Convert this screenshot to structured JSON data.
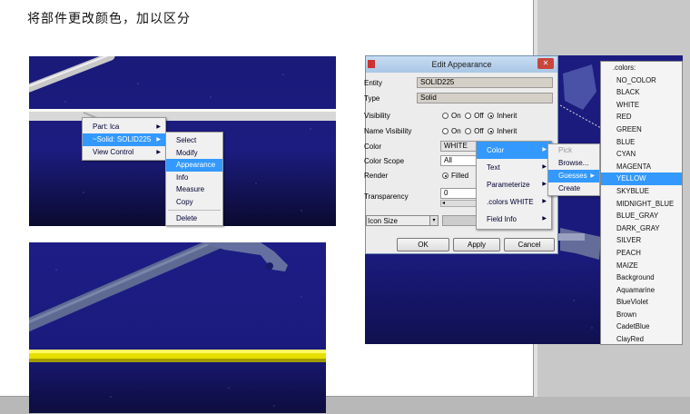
{
  "title": "将部件更改颜色，加以区分",
  "ctx_menu": {
    "level1": [
      {
        "label": "Part: lca",
        "arrow": true
      },
      {
        "label": "~Solid: SOLID225",
        "arrow": true,
        "selected": true
      },
      {
        "label": "View Control",
        "arrow": true
      }
    ],
    "level2": [
      "Select",
      "Modify",
      "Appearance",
      "Info",
      "Measure",
      "Copy",
      "Delete"
    ],
    "level2_selected": "Appearance"
  },
  "dialog": {
    "title": "Edit Appearance",
    "close": "✕",
    "labels": {
      "entity": "Entity",
      "type": "Type",
      "visibility": "Visibility",
      "name_visibility": "Name Visibility",
      "color": "Color",
      "color_scope": "Color Scope",
      "render": "Render",
      "transparency": "Transparency",
      "icon_size": "Icon Size"
    },
    "entity_value": "SOLID225",
    "type_value": "Solid",
    "radio_on": "On",
    "radio_off": "Off",
    "radio_inherit": "Inherit",
    "color_value": "WHITE",
    "color_scope_value": "All",
    "render_value": "Filled",
    "transparency_value": "0",
    "buttons": {
      "ok": "OK",
      "apply": "Apply",
      "cancel": "Cancel"
    }
  },
  "color_menu": {
    "items": [
      {
        "label": "Color",
        "arrow": true,
        "selected": true
      },
      {
        "label": "Text",
        "arrow": true
      },
      {
        "label": "Parameterize",
        "arrow": true
      },
      {
        "label": ".colors WHITE",
        "arrow": true
      },
      {
        "label": "Field Info",
        "arrow": true
      }
    ]
  },
  "pick_menu": {
    "items": [
      {
        "label": "Pick",
        "disabled": true
      },
      {
        "label": "Browse..."
      },
      {
        "label": "Guesses",
        "arrow": true,
        "selected": true
      },
      {
        "label": "Create"
      }
    ]
  },
  "colors_list": {
    "header": ".colors:",
    "items": [
      "NO_COLOR",
      "BLACK",
      "WHITE",
      "RED",
      "GREEN",
      "BLUE",
      "CYAN",
      "MAGENTA",
      "YELLOW",
      "SKYBLUE",
      "MIDNIGHT_BLUE",
      "BLUE_GRAY",
      "DARK_GRAY",
      "SILVER",
      "PEACH",
      "MAIZE",
      "Background",
      "Aquamarine",
      "BlueViolet",
      "Brown",
      "CadetBlue",
      "ClayRed"
    ],
    "selected": "YELLOW"
  }
}
